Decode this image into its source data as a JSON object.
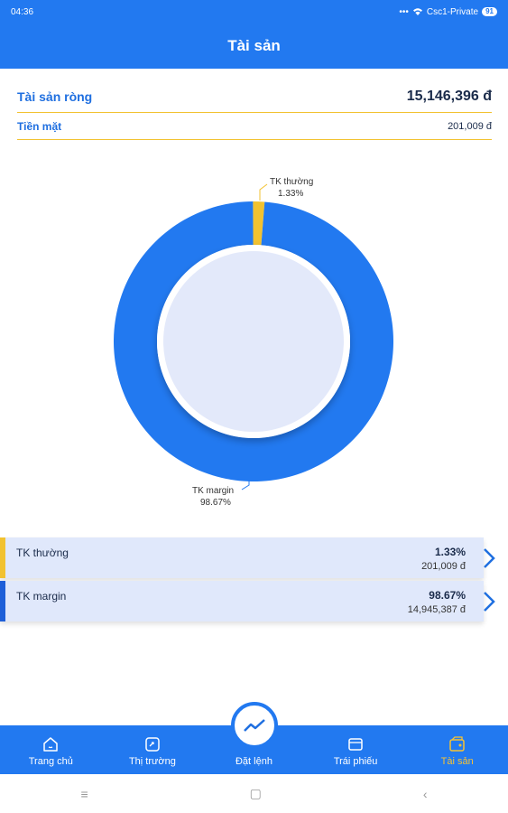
{
  "status": {
    "time": "04:36",
    "dots": "•••",
    "network": "Csc1-Private",
    "battery": "91"
  },
  "header": {
    "title": "Tài sản"
  },
  "summary": {
    "net_label": "Tài sản ròng",
    "net_value": "15,146,396 đ",
    "cash_label": "Tiền mặt",
    "cash_value": "201,009 đ"
  },
  "chart_data": {
    "type": "pie",
    "donut": true,
    "slices": [
      {
        "label": "TK thường",
        "percent_label": "1.33%",
        "value": 1.33,
        "color": "#f2c230"
      },
      {
        "label": "TK margin",
        "percent_label": "98.67%",
        "value": 98.67,
        "color": "#2279f0"
      }
    ]
  },
  "accounts": [
    {
      "name": "TK thường",
      "percent": "1.33%",
      "value": "201,009 đ",
      "color": "#f2c230"
    },
    {
      "name": "TK margin",
      "percent": "98.67%",
      "value": "14,945,387 đ",
      "color": "#1e5fd8"
    }
  ],
  "nav": {
    "items": [
      {
        "label": "Trang chủ",
        "icon": "home-icon"
      },
      {
        "label": "Thị trường",
        "icon": "market-icon"
      },
      {
        "label": "Đặt lệnh",
        "icon": "trend-icon"
      },
      {
        "label": "Trái phiếu",
        "icon": "wallet-icon"
      },
      {
        "label": "Tài sản",
        "icon": "assets-icon",
        "active": true
      }
    ]
  },
  "system_nav": {
    "menu": "≡",
    "home": "▢",
    "back": "‹"
  }
}
